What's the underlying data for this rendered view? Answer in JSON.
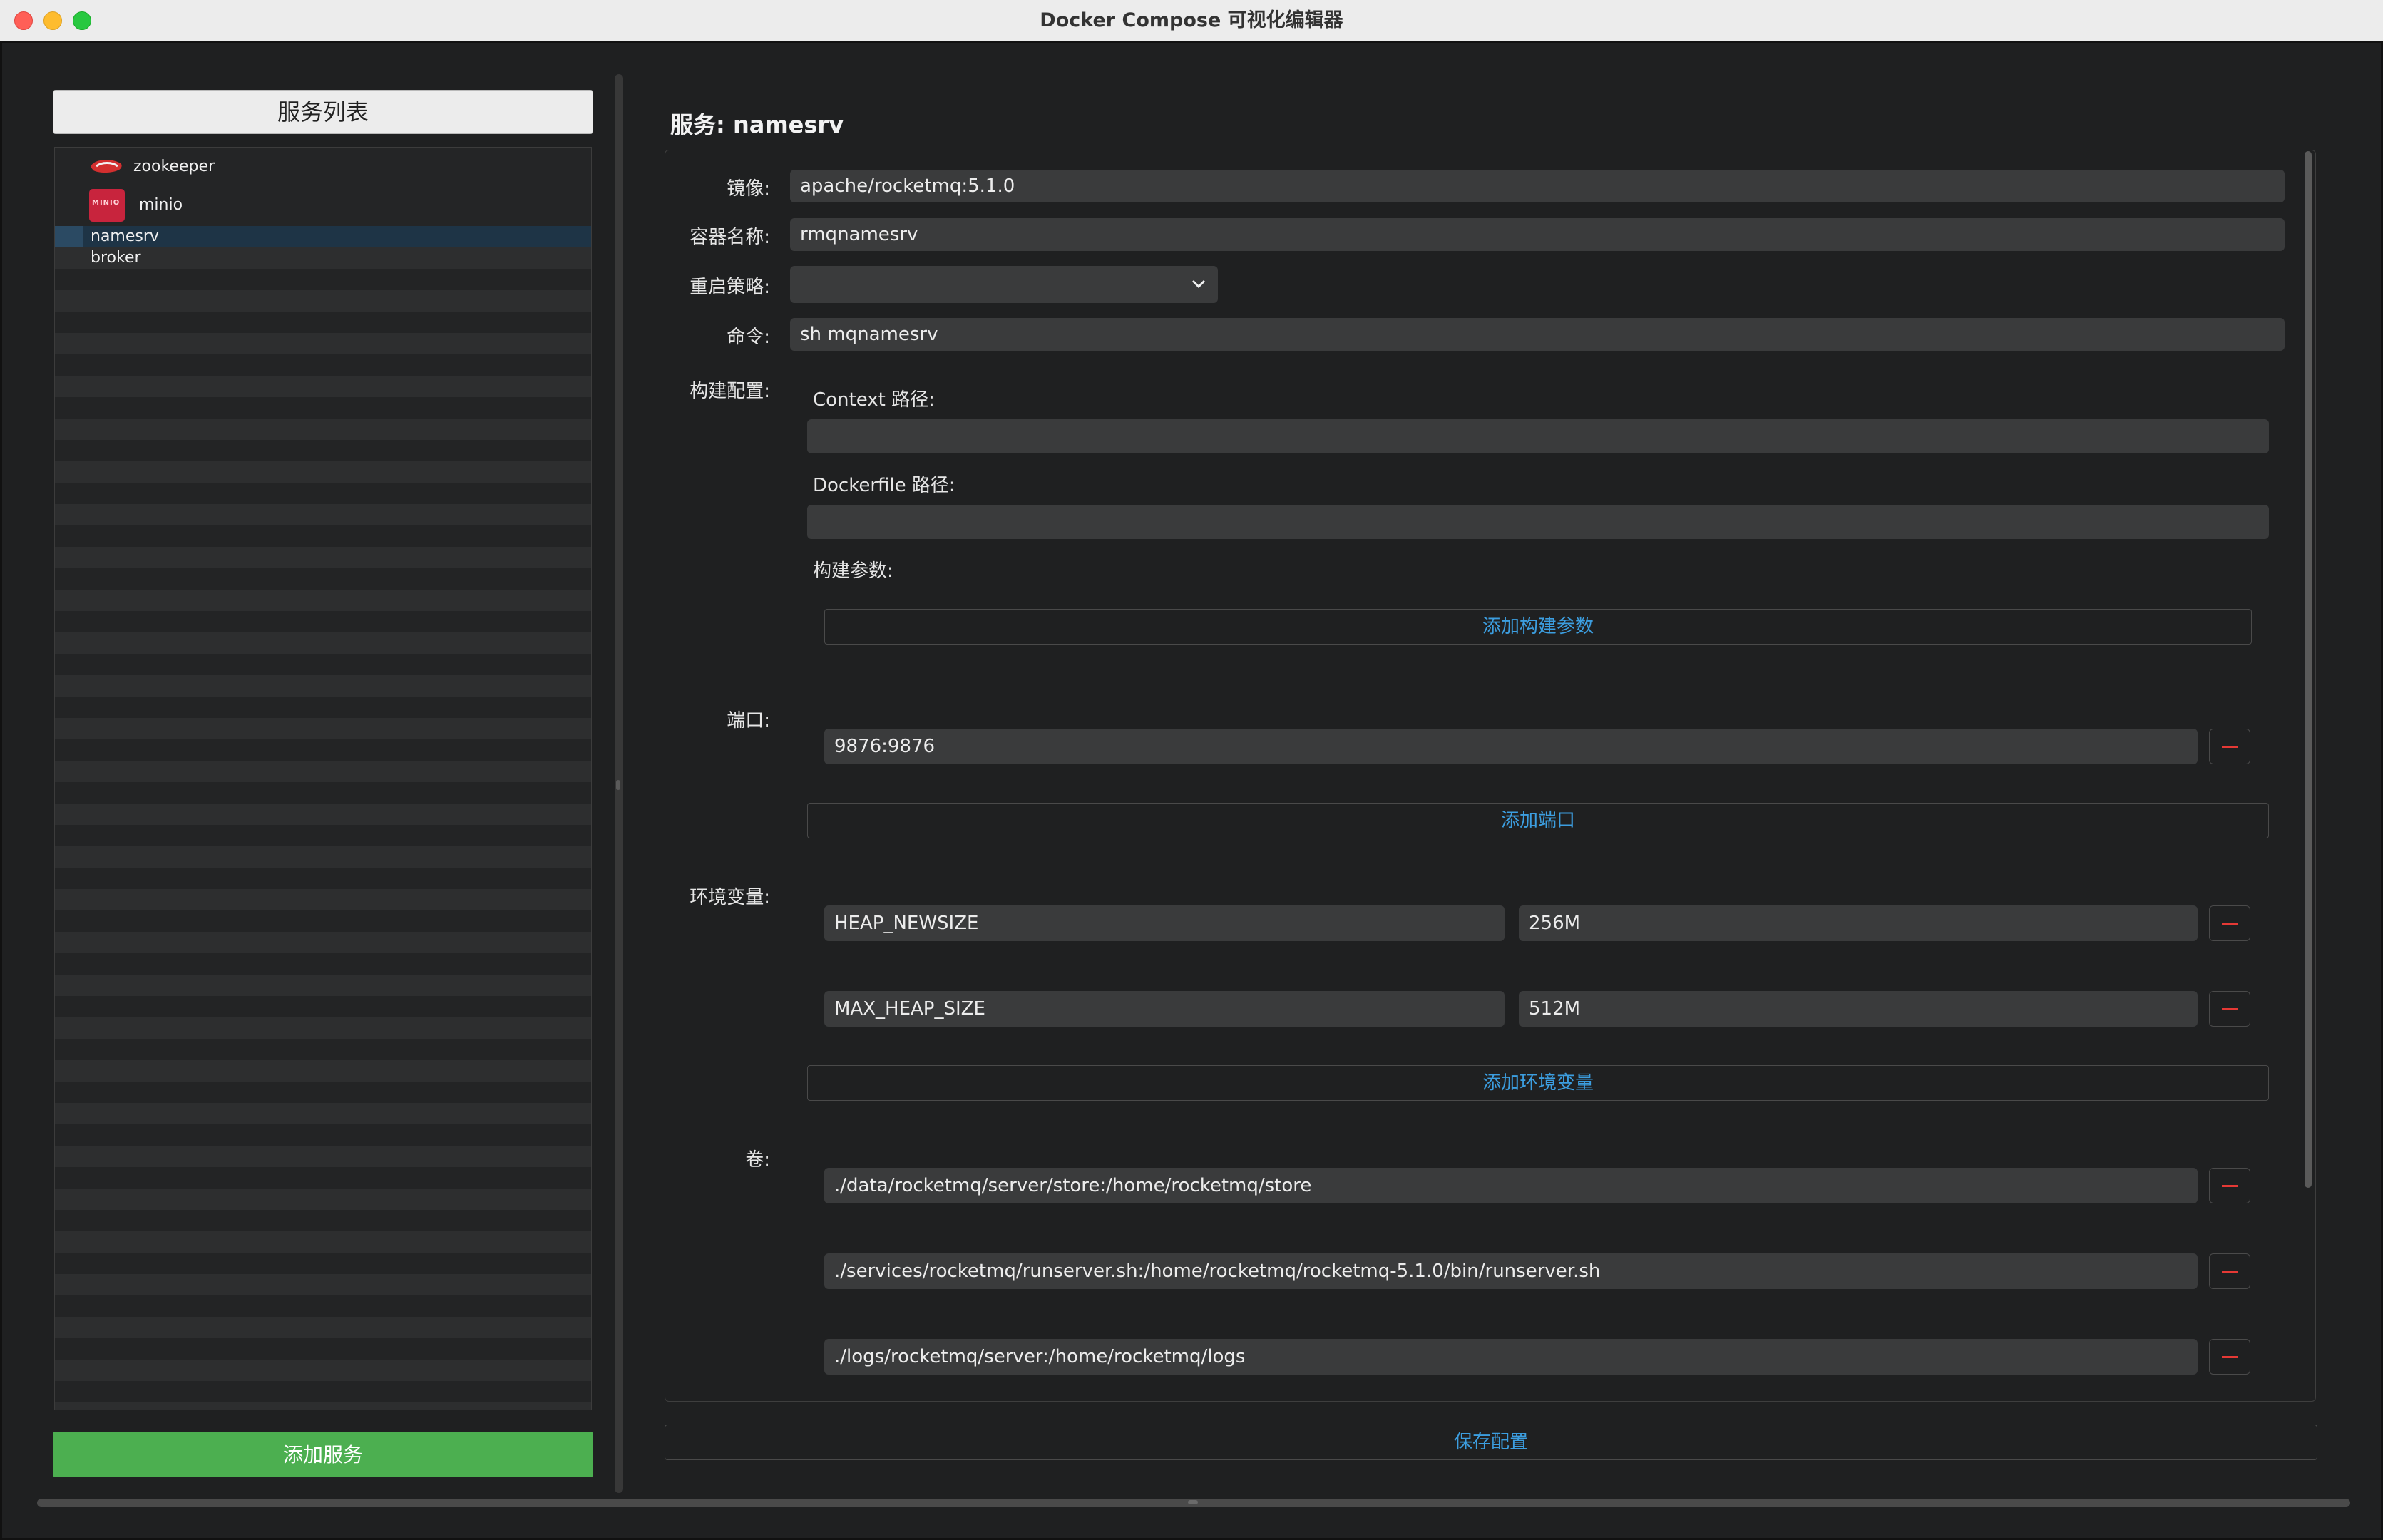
{
  "window": {
    "title": "Docker Compose 可视化编辑器"
  },
  "sidebar": {
    "header": "服务列表",
    "services": [
      {
        "name": "zookeeper",
        "icon": "zookeeper-icon"
      },
      {
        "name": "minio",
        "icon": "minio-icon"
      },
      {
        "name": "namesrv",
        "selected": true
      },
      {
        "name": "broker"
      }
    ],
    "minio_logo_text": "MINIO",
    "add_button": "添加服务"
  },
  "service": {
    "title": "服务: namesrv",
    "image_label": "镜像:",
    "image_value": "apache/rocketmq:5.1.0",
    "container_label": "容器名称:",
    "container_value": "rmqnamesrv",
    "restart_label": "重启策略:",
    "restart_value": "",
    "command_label": "命令:",
    "command_value": "sh mqnamesrv",
    "build": {
      "label": "构建配置:",
      "context_label": "Context 路径:",
      "context_value": "",
      "dockerfile_label": "Dockerfile 路径:",
      "dockerfile_value": "",
      "args_label": "构建参数:",
      "add_args_button": "添加构建参数"
    },
    "ports": {
      "label": "端口:",
      "items": [
        "9876:9876"
      ],
      "add_button": "添加端口"
    },
    "env": {
      "label": "环境变量:",
      "items": [
        {
          "key": "HEAP_NEWSIZE",
          "value": "256M"
        },
        {
          "key": "MAX_HEAP_SIZE",
          "value": "512M"
        }
      ],
      "add_button": "添加环境变量"
    },
    "volumes": {
      "label": "卷:",
      "items": [
        "./data/rocketmq/server/store:/home/rocketmq/store",
        "./services/rocketmq/runserver.sh:/home/rocketmq/rocketmq-5.1.0/bin/runserver.sh",
        "./logs/rocketmq/server:/home/rocketmq/logs"
      ]
    }
  },
  "save_button": "保存配置",
  "colors": {
    "accent_link": "#3c9ee0",
    "add_service_green": "#4caf50",
    "delete_red": "#e53935",
    "selection": "#1e3446"
  }
}
